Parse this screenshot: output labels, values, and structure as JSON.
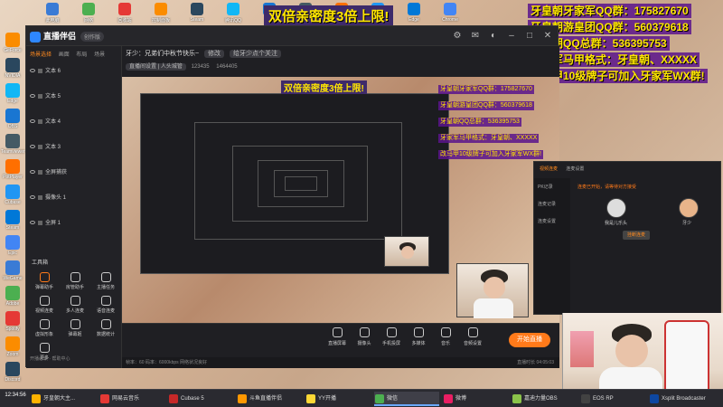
{
  "banner": "双倍亲密度3倍上限!",
  "qq_lines": [
    "牙皇朝牙家军QQ群：175827670",
    "牙皇朝游皇团QQ群：560379618",
    "牙皇朝QQ总群：536395753",
    "牙家军马甲格式：牙皇朝、XXXXX",
    "改马甲10级牌子可加入牙家军WX群!"
  ],
  "app": {
    "name": "直播伴侣",
    "version": "创作版",
    "header_title": "牙少：兄弟们中秋节快乐~",
    "header_edit": "修改",
    "header_title2": "给牙少点个关注",
    "header_tag": "直播间设置 | 人头城管",
    "room_id": "123435",
    "viewers": "1464405",
    "sidebar_tabs": [
      "场景选择",
      "画面",
      "布局",
      "场景"
    ],
    "sources": [
      "文本 6",
      "文本 5",
      "文本 4",
      "文本 3",
      "全屏捕获",
      "摄像头 1",
      "全屏 1"
    ],
    "toolbox_title": "工具箱",
    "tools": [
      "弹幕助手",
      "房管助手",
      "主播任务",
      "视频连麦",
      "多人连麦",
      "语音连麦",
      "虚拟形象",
      "弹幕姬",
      "数据统计",
      "更多"
    ],
    "sidebar_footer": "开播必读 · 帮助中心",
    "controls": [
      "直播屏幕",
      "摄像头",
      "手机投屏",
      "多媒体",
      "音乐",
      "音频设置"
    ],
    "live_button": "开始直播",
    "status_left": "帧率：60  码率：6000kbps  网络状况良好",
    "status_right": "直播时长 04:05:03"
  },
  "popup": {
    "tabs": [
      "视频连麦",
      "连麦设置"
    ],
    "menu": [
      "PK记录",
      "连麦记录",
      "连麦设置"
    ],
    "message": "连麦已开始，请等待对方接受",
    "users": [
      "我是儿乐头",
      "牙少"
    ],
    "hangup": "挂断连麦"
  },
  "taskbar": {
    "time": "12:34:56",
    "items": [
      "牙皇朝大主...",
      "网易云音乐",
      "Cubase 5",
      "斗鱼直播伴侣",
      "YY开播",
      "微信",
      "微博",
      "嘉迪力量OBS",
      "EOS RP",
      "Xsplit Broadcaster"
    ]
  },
  "desktop_icons_top": [
    "此电脑",
    "网络",
    "回收站",
    "控制面板",
    "Steam",
    "腾讯QQ",
    "迅雷",
    "Windows",
    "WeGame",
    "百度网盘",
    "Edge",
    "Chrome"
  ],
  "desktop_icons_left": [
    "GeForce",
    "NVIDIA",
    "Edge",
    "OBS",
    "Teamviewer",
    "PotPlayer",
    "Cubase",
    "Steam",
    "Epic",
    "WeGame",
    "Adobe",
    "Spotify",
    "Zoom",
    "Discord"
  ]
}
